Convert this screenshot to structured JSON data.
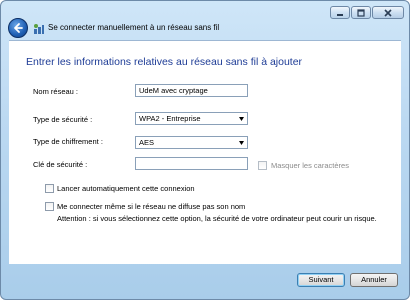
{
  "window": {
    "title": "Se connecter manuellement à un réseau sans fil",
    "controls": [
      "minimize",
      "maximize",
      "close"
    ]
  },
  "heading": "Entrer les informations relatives au réseau sans fil à ajouter",
  "form": {
    "network_name_label": "Nom réseau :",
    "network_name_value": "UdeM avec cryptage",
    "security_type_label": "Type de sécurité :",
    "security_type_value": "WPA2 - Entreprise",
    "encryption_type_label": "Type de chiffrement :",
    "encryption_type_value": "AES",
    "security_key_label": "Clé de sécurité :",
    "security_key_value": "",
    "hide_chars_label": "Masquer les caractères"
  },
  "options": {
    "auto_connect_label": "Lancer automatiquement cette connexion",
    "connect_hidden_label": "Me connecter même si le réseau ne diffuse pas son nom",
    "warning_text": "Attention : si vous sélectionnez cette option, la sécurité de votre ordinateur peut courir un risque."
  },
  "buttons": {
    "next": "Suivant",
    "cancel": "Annuler"
  },
  "colors": {
    "heading": "#1e3c96",
    "titlebar": "#bcd9f2"
  }
}
